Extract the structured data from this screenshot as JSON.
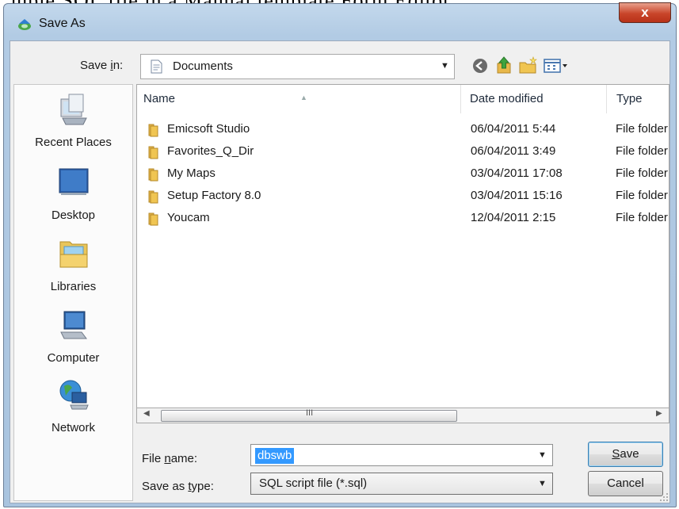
{
  "background_text": "mple SQL file in a Manual template Form Editor",
  "window": {
    "title": "Save As",
    "close_label": "x"
  },
  "save_in": {
    "label_pre": "Save ",
    "label_accel": "i",
    "label_post": "n:",
    "location": "Documents"
  },
  "places": [
    {
      "label": "Recent Places",
      "icon": "recent-places-icon"
    },
    {
      "label": "Desktop",
      "icon": "desktop-icon"
    },
    {
      "label": "Libraries",
      "icon": "libraries-icon"
    },
    {
      "label": "Computer",
      "icon": "computer-icon"
    },
    {
      "label": "Network",
      "icon": "network-icon"
    }
  ],
  "columns": {
    "name": "Name",
    "date": "Date modified",
    "type": "Type"
  },
  "files": [
    {
      "name": "Emicsoft Studio",
      "date": "06/04/2011 5:44",
      "type": "File folder"
    },
    {
      "name": "Favorites_Q_Dir",
      "date": "06/04/2011 3:49",
      "type": "File folder"
    },
    {
      "name": "My Maps",
      "date": "03/04/2011 17:08",
      "type": "File folder"
    },
    {
      "name": "Setup Factory 8.0",
      "date": "03/04/2011 15:16",
      "type": "File folder"
    },
    {
      "name": "Youcam",
      "date": "12/04/2011 2:15",
      "type": "File folder"
    }
  ],
  "scrollbar": {
    "grip": "III"
  },
  "file_name": {
    "label_pre": "File ",
    "label_accel": "n",
    "label_post": "ame:",
    "value": "dbswb"
  },
  "save_as_type": {
    "label_pre": "Save as ",
    "label_accel": "t",
    "label_post": "ype:",
    "value": "SQL script file (*.sql)"
  },
  "buttons": {
    "save_accel": "S",
    "save_rest": "ave",
    "cancel": "Cancel"
  },
  "colors": {
    "selection": "#3399ff",
    "frame": "#b2cbe4",
    "close": "#c9452a",
    "folder": "#e8b84a"
  }
}
